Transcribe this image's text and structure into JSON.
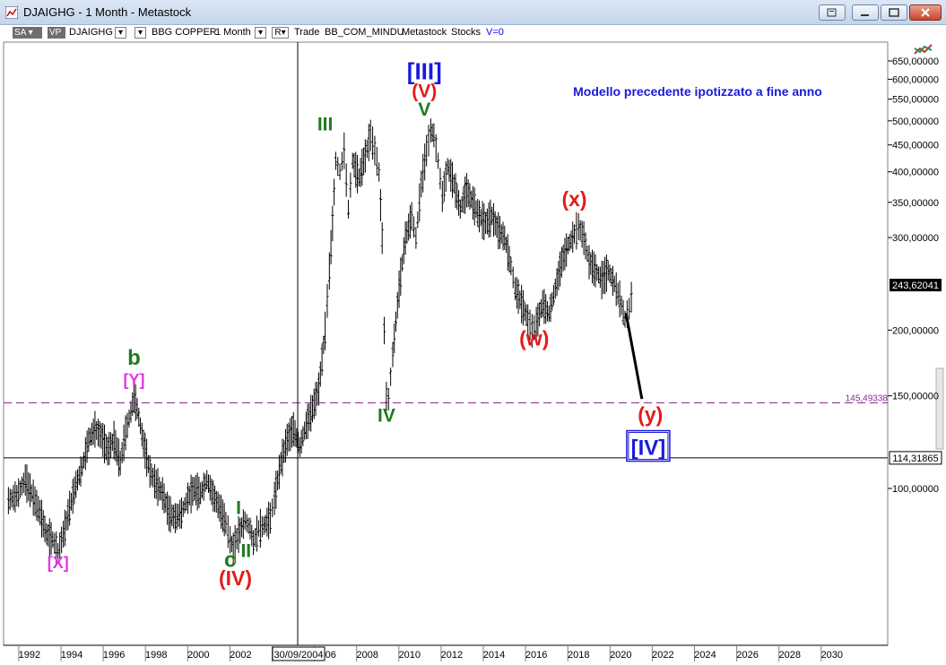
{
  "window": {
    "title": "DJAIGHG - 1 Month - Metastock"
  },
  "toolbar": {
    "sa_label": "SA",
    "vp_label": "VP",
    "symbol": "DJAIGHG",
    "security_name": "BBG COPPER",
    "period": "1 Month",
    "r_label": "R",
    "trade_label": "Trade",
    "code": "BB_COM_MINDU",
    "source": "Metastock",
    "type": "Stocks",
    "v_equals": "V=0"
  },
  "chart_data": {
    "type": "line",
    "title": "",
    "xlabel": "",
    "ylabel": "",
    "scale": "log",
    "xlim": [
      1991.0,
      2031.5
    ],
    "ylim": [
      75,
      800
    ],
    "x_ticks": [
      "1992",
      "1994",
      "1996",
      "1998",
      "2000",
      "2002",
      "2004",
      "2006",
      "2008",
      "2010",
      "2012",
      "2014",
      "2016",
      "2018",
      "2020",
      "2022",
      "2024",
      "2026",
      "2028",
      "2030"
    ],
    "x_tick_values": [
      1992,
      1994,
      1996,
      1998,
      2000,
      2002,
      2004,
      2006,
      2008,
      2010,
      2012,
      2014,
      2016,
      2018,
      2020,
      2022,
      2024,
      2026,
      2028,
      2030
    ],
    "y_ticks": [
      {
        "v": 650,
        "label": "650,00000"
      },
      {
        "v": 600,
        "label": "600,00000"
      },
      {
        "v": 550,
        "label": "550,00000"
      },
      {
        "v": 500,
        "label": "500,00000"
      },
      {
        "v": 450,
        "label": "450,00000"
      },
      {
        "v": 400,
        "label": "400,00000"
      },
      {
        "v": 350,
        "label": "350,00000"
      },
      {
        "v": 300,
        "label": "300,00000"
      },
      {
        "v": 200,
        "label": "200,00000"
      },
      {
        "v": 150,
        "label": "150,00000"
      },
      {
        "v": 100,
        "label": "100,00000"
      }
    ],
    "cursor_date": "30/09/2004",
    "cursor_x": 2004.7,
    "cursor_price": 114.31865,
    "cursor_price_label": "114,31865",
    "last_price": 243.62041,
    "last_price_label": "243,62041",
    "hline": 145.49338,
    "hline_label": "145,49338",
    "series": [
      {
        "points": [
          [
            1991.0,
            95
          ],
          [
            1991.4,
            97
          ],
          [
            1991.8,
            104
          ],
          [
            1992.1,
            98
          ],
          [
            1992.5,
            90
          ],
          [
            1992.8,
            82
          ],
          [
            1993.1,
            80
          ],
          [
            1993.35,
            76
          ],
          [
            1993.6,
            82
          ],
          [
            1993.9,
            92
          ],
          [
            1994.2,
            102
          ],
          [
            1994.5,
            110
          ],
          [
            1994.8,
            124
          ],
          [
            1995.1,
            130
          ],
          [
            1995.4,
            126
          ],
          [
            1995.7,
            118
          ],
          [
            1996.0,
            124
          ],
          [
            1996.3,
            112
          ],
          [
            1996.55,
            128
          ],
          [
            1996.8,
            140
          ],
          [
            1996.95,
            150
          ],
          [
            1997.1,
            142
          ],
          [
            1997.4,
            122
          ],
          [
            1997.7,
            108
          ],
          [
            1998.0,
            102
          ],
          [
            1998.3,
            98
          ],
          [
            1998.6,
            90
          ],
          [
            1998.9,
            88
          ],
          [
            1999.2,
            90
          ],
          [
            1999.5,
            96
          ],
          [
            1999.8,
            100
          ],
          [
            2000.1,
            98
          ],
          [
            2000.4,
            104
          ],
          [
            2000.7,
            97
          ],
          [
            2001.0,
            92
          ],
          [
            2001.3,
            86
          ],
          [
            2001.5,
            80
          ],
          [
            2001.65,
            77
          ],
          [
            2001.9,
            82
          ],
          [
            2002.2,
            87
          ],
          [
            2002.45,
            84
          ],
          [
            2002.6,
            79
          ],
          [
            2002.85,
            84
          ],
          [
            2003.1,
            85
          ],
          [
            2003.4,
            88
          ],
          [
            2003.6,
            96
          ],
          [
            2003.9,
            112
          ],
          [
            2004.2,
            124
          ],
          [
            2004.5,
            130
          ],
          [
            2004.8,
            120
          ],
          [
            2005.1,
            132
          ],
          [
            2005.4,
            142
          ],
          [
            2005.7,
            155
          ],
          [
            2006.0,
            200
          ],
          [
            2006.2,
            260
          ],
          [
            2006.35,
            320
          ],
          [
            2006.5,
            420
          ],
          [
            2006.7,
            400
          ],
          [
            2006.9,
            440
          ],
          [
            2007.1,
            340
          ],
          [
            2007.3,
            420
          ],
          [
            2007.6,
            390
          ],
          [
            2007.9,
            430
          ],
          [
            2008.15,
            470
          ],
          [
            2008.35,
            440
          ],
          [
            2008.55,
            400
          ],
          [
            2008.7,
            300
          ],
          [
            2008.8,
            200
          ],
          [
            2008.9,
            150
          ],
          [
            2009.0,
            148
          ],
          [
            2009.2,
            180
          ],
          [
            2009.5,
            240
          ],
          [
            2009.8,
            300
          ],
          [
            2010.1,
            330
          ],
          [
            2010.3,
            300
          ],
          [
            2010.55,
            380
          ],
          [
            2010.8,
            440
          ],
          [
            2011.0,
            480
          ],
          [
            2011.15,
            470
          ],
          [
            2011.35,
            420
          ],
          [
            2011.55,
            360
          ],
          [
            2011.8,
            410
          ],
          [
            2012.1,
            380
          ],
          [
            2012.4,
            340
          ],
          [
            2012.7,
            370
          ],
          [
            2013.0,
            350
          ],
          [
            2013.3,
            330
          ],
          [
            2013.6,
            320
          ],
          [
            2013.9,
            330
          ],
          [
            2014.2,
            310
          ],
          [
            2014.5,
            300
          ],
          [
            2014.8,
            265
          ],
          [
            2015.0,
            240
          ],
          [
            2015.3,
            225
          ],
          [
            2015.6,
            210
          ],
          [
            2015.8,
            200
          ],
          [
            2016.0,
            205
          ],
          [
            2016.3,
            225
          ],
          [
            2016.6,
            215
          ],
          [
            2016.9,
            240
          ],
          [
            2017.2,
            270
          ],
          [
            2017.5,
            290
          ],
          [
            2017.8,
            305
          ],
          [
            2018.0,
            315
          ],
          [
            2018.25,
            300
          ],
          [
            2018.5,
            270
          ],
          [
            2018.8,
            260
          ],
          [
            2019.1,
            250
          ],
          [
            2019.4,
            260
          ],
          [
            2019.7,
            245
          ],
          [
            2019.95,
            230
          ],
          [
            2020.2,
            210
          ],
          [
            2020.4,
            220
          ],
          [
            2020.6,
            243.62
          ]
        ]
      }
    ],
    "projection": [
      [
        2020.25,
        215
      ],
      [
        2021.0,
        148
      ]
    ]
  },
  "annotations": [
    {
      "text": "[III]",
      "x": 2010.7,
      "v": 600,
      "color": "#1a1adc",
      "size": 26
    },
    {
      "text": "(V)",
      "x": 2010.7,
      "v": 555,
      "color": "#e31b1b",
      "size": 21
    },
    {
      "text": "V",
      "x": 2010.7,
      "v": 512,
      "color": "#1f7a1f",
      "size": 21
    },
    {
      "text": "III",
      "x": 2006.0,
      "v": 480,
      "color": "#1f7a1f",
      "size": 21
    },
    {
      "text": "IV",
      "x": 2008.9,
      "v": 134,
      "color": "#1f7a1f",
      "size": 21
    },
    {
      "text": "(x)",
      "x": 2017.8,
      "v": 344,
      "color": "#e31b1b",
      "size": 23
    },
    {
      "text": "(w)",
      "x": 2015.9,
      "v": 187,
      "color": "#e31b1b",
      "size": 23
    },
    {
      "text": "(y)",
      "x": 2021.4,
      "v": 134,
      "color": "#e31b1b",
      "size": 23
    },
    {
      "text": "b",
      "x": 1996.95,
      "v": 172,
      "color": "#1f7a1f",
      "size": 24
    },
    {
      "text": "[Y]",
      "x": 1996.95,
      "v": 157,
      "color": "#e535e5",
      "size": 18
    },
    {
      "text": "[X]",
      "x": 1993.35,
      "v": 70.5,
      "color": "#e535e5",
      "size": 18
    },
    {
      "text": "c",
      "x": 2001.5,
      "v": 71,
      "color": "#1f7a1f",
      "size": 24
    },
    {
      "text": "(IV)",
      "x": 2001.75,
      "v": 65.5,
      "color": "#e31b1b",
      "size": 23
    },
    {
      "text": "I",
      "x": 2001.9,
      "v": 89.5,
      "color": "#1f7a1f",
      "size": 21
    },
    {
      "text": "II",
      "x": 2002.25,
      "v": 74,
      "color": "#1f7a1f",
      "size": 21
    }
  ],
  "iv_box": {
    "text": "[IV]",
    "x": 2021.3,
    "v": 120,
    "color": "#1a1adc"
  },
  "note": {
    "text": "Modello precedente ipotizzato a fine anno",
    "color": "#1a1adc"
  },
  "colors": {
    "hline": "#8b2a8b",
    "projection": "#000000",
    "bars": "#000000"
  }
}
